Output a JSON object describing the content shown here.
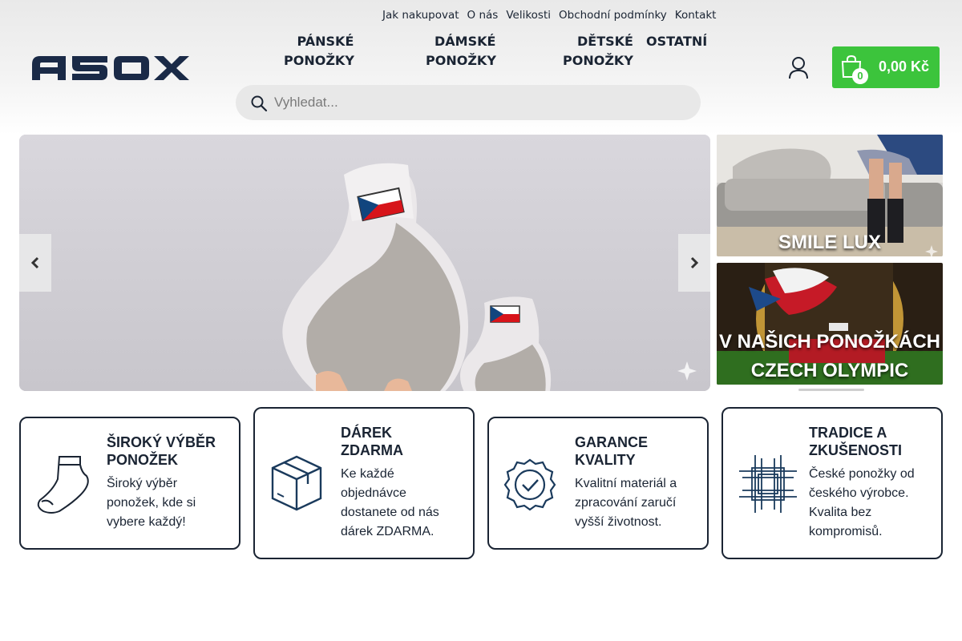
{
  "header": {
    "top_links": [
      "Jak nakupovat",
      "O nás",
      "Velikosti",
      "Obchodní podmínky",
      "Kontakt"
    ],
    "logo_text": "ASOX",
    "nav": [
      {
        "line1": "PÁNSKÉ",
        "line2": "PONOŽKY"
      },
      {
        "line1": "DÁMSKÉ",
        "line2": "PONOŽKY"
      },
      {
        "line1": "DĚTSKÉ",
        "line2": "PONOŽKY"
      },
      {
        "line1": "OSTATNÍ",
        "line2": ""
      }
    ],
    "search": {
      "placeholder": "Vyhledat...",
      "value": "",
      "icon": "search-icon"
    },
    "user_icon": "user-icon",
    "cart": {
      "count": "0",
      "price": "0,00 Kč",
      "icon": "shopping-bag-icon"
    }
  },
  "colors": {
    "accent": "#3cc43c",
    "primary": "#1a2433"
  },
  "slider": {
    "icon_prev": "chevron-left-icon",
    "icon_next": "chevron-right-icon"
  },
  "side_banners": [
    {
      "caption_line1": "SMILE LUX",
      "caption_line2": ""
    },
    {
      "caption_line1": "V NAŠICH PONOŽKÁCH",
      "caption_line2": "CZECH OLYMPIC"
    }
  ],
  "features": [
    {
      "title": "ŠIROKÝ VÝBĚR PONOŽEK",
      "desc": "Široký výběr ponožek, kde si vybere každý!",
      "icon": "sock-icon"
    },
    {
      "title": "DÁREK ZDARMA",
      "desc": "Ke každé objednávce dostanete od nás dárek ZDARMA.",
      "icon": "box-icon"
    },
    {
      "title": "GARANCE KVALITY",
      "desc": "Kvalitní materiál a zpracování zaručí vyšší životnost.",
      "icon": "quality-badge-icon"
    },
    {
      "title": "TRADICE A ZKUŠENOSTI",
      "desc": "České ponožky od českého výrobce. Kvalita bez kompromisů.",
      "icon": "tradition-weave-icon"
    }
  ]
}
